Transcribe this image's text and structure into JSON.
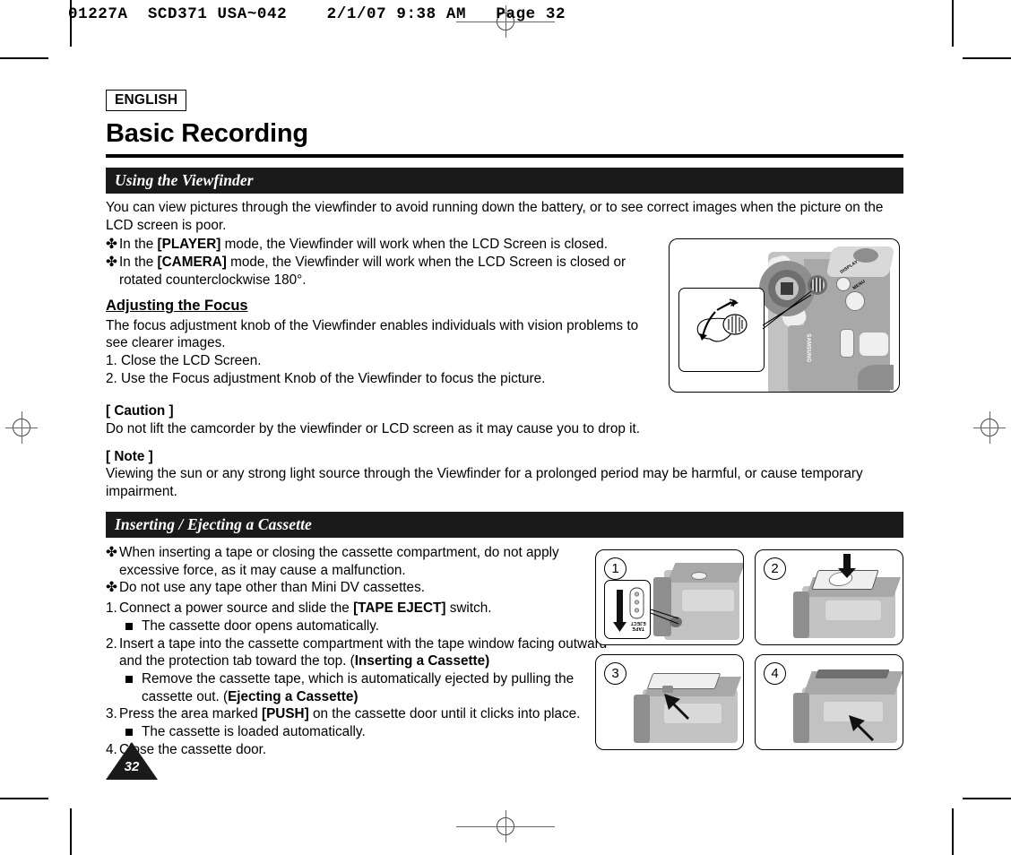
{
  "prepress": {
    "slug": "01227A  SCD371 USA~042    2/1/07 9:38 AM   Page 32"
  },
  "header": {
    "language_badge": "ENGLISH",
    "title": "Basic Recording"
  },
  "sections": [
    {
      "bar_title": "Using the Viewfinder",
      "intro": "You can view pictures through the viewfinder to avoid running down the battery, or to see correct images when the picture on the LCD screen is poor.",
      "bullets": [
        {
          "pre": "In the ",
          "bold": "[PLAYER]",
          "post": " mode, the Viewfinder will work when the LCD Screen is closed."
        },
        {
          "pre": "In the ",
          "bold": "[CAMERA]",
          "post": " mode, the Viewfinder will work when the LCD Screen is closed or rotated counterclockwise 180°."
        }
      ],
      "sub_head": "Adjusting the Focus",
      "sub_body": "The focus adjustment knob of the Viewfinder enables individuals with vision problems to see clearer images.",
      "steps": [
        "1. Close the LCD Screen.",
        "2. Use the Focus adjustment Knob of the Viewfinder to focus the picture."
      ],
      "caution_head": "[ Caution ]",
      "caution_body": "Do not lift the camcorder by the viewfinder or LCD screen as it may cause you to drop it.",
      "note_head": "[ Note ]",
      "note_body": "Viewing the sun or any strong light source through the Viewfinder for a prolonged period may be harmful, or cause temporary impairment."
    },
    {
      "bar_title": "Inserting / Ejecting a Cassette",
      "bullets": [
        "When inserting a tape or closing the cassette compartment, do not apply excessive force, as it may cause a malfunction.",
        "Do not use any tape other than Mini DV cassettes."
      ],
      "steps": [
        {
          "num": "1.",
          "pre": "Connect a power source and slide the ",
          "bold": "[TAPE EJECT]",
          "post": " switch.",
          "sub": [
            {
              "text": "The cassette door opens automatically."
            }
          ]
        },
        {
          "num": "2.",
          "pre": "Insert a tape into the cassette compartment with the tape window facing outward and the protection tab toward the top. (",
          "bold": "Inserting a Cassette)",
          "post": "",
          "sub": [
            {
              "pre": "Remove the cassette tape, which is automatically ejected by pulling the cassette out. (",
              "bold": "Ejecting a Cassette)"
            }
          ]
        },
        {
          "num": "3.",
          "pre": "Press the area marked ",
          "bold": "[PUSH]",
          "post": " on the cassette door until it clicks into place.",
          "sub": [
            {
              "text": "The cassette is loaded automatically."
            }
          ]
        },
        {
          "num": "4.",
          "pre": "Close the cassette door.",
          "bold": "",
          "post": "",
          "sub": []
        }
      ]
    }
  ],
  "illustrations": {
    "viewfinder": {
      "name": "camcorder-viewfinder-focus-knob",
      "button_labels": [
        "DISPLAY",
        "MENU"
      ],
      "brand": "SAMSUNG"
    },
    "steps": [
      {
        "number": "1",
        "name": "tape-eject-switch-slide",
        "inset_label": "TAPE\nEJECT"
      },
      {
        "number": "2",
        "name": "insert-cassette-into-compartment"
      },
      {
        "number": "3",
        "name": "press-push-area-on-door"
      },
      {
        "number": "4",
        "name": "close-cassette-door"
      }
    ]
  },
  "footer": {
    "page_number": "32"
  },
  "colors": {
    "bar_background": "#1a1a1a",
    "bar_text": "#ffffff",
    "rule": "#000000"
  }
}
